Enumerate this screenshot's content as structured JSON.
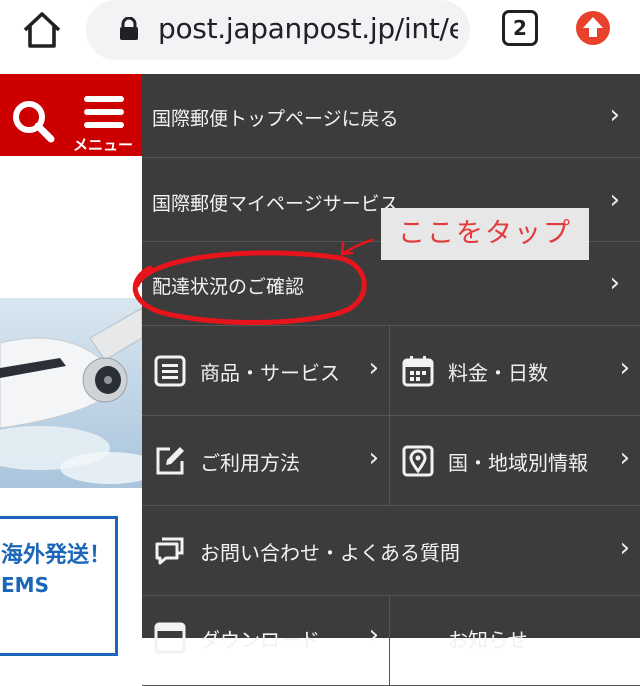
{
  "browser": {
    "url": "post.japanpost.jp/int/en",
    "tab_count": "2"
  },
  "page": {
    "menu_label": "メニュー",
    "promo_line1": "海外発送！",
    "promo_line2": "EMS"
  },
  "menu": {
    "top_items": [
      {
        "label": "国際郵便トップページに戻る"
      },
      {
        "label": "国際郵便マイページサービス"
      },
      {
        "label": "配達状況のご確認"
      }
    ],
    "grid": [
      {
        "label": "商品・サービス",
        "icon": "list-icon"
      },
      {
        "label": "料金・日数",
        "icon": "calendar-icon"
      },
      {
        "label": "ご利用方法",
        "icon": "edit-icon"
      },
      {
        "label": "国・地域別情報",
        "icon": "map-pin-icon"
      },
      {
        "label": "お問い合わせ・よくある質問",
        "icon": "chat-icon"
      },
      {
        "label": "ダウンロード",
        "icon": "download-icon"
      },
      {
        "label": "お知らせ",
        "icon": "notice-icon"
      }
    ]
  },
  "annotation": {
    "tooltip": "ここをタップ",
    "color": "#e8141b"
  }
}
